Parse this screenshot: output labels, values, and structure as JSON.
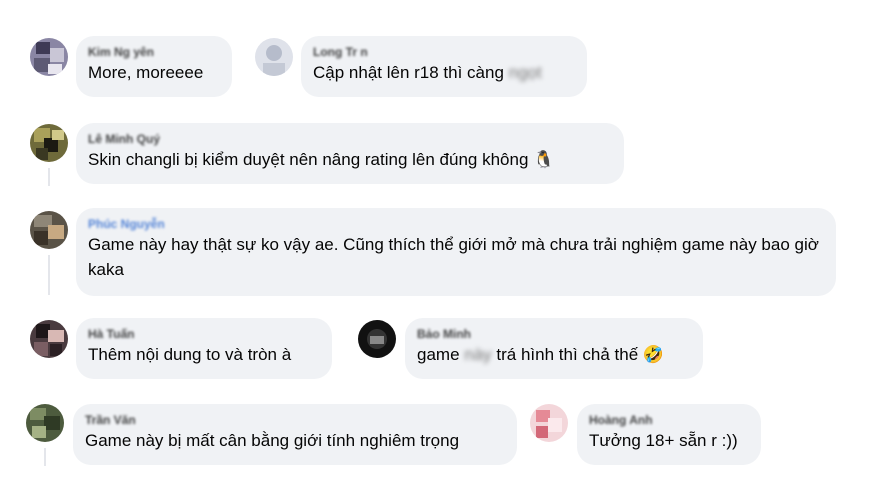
{
  "comments": [
    {
      "id": "c1",
      "author": "Kim Ng yên",
      "text": "More, moreeee",
      "blurred": ""
    },
    {
      "id": "c2",
      "author": "Long Tr n",
      "text": "Cập nhật lên r18 thì càng ",
      "blurred": "ngọt"
    },
    {
      "id": "c3",
      "author": "Lê Minh Quý",
      "text": "Skin changli bị kiểm duyệt nên nâng rating lên đúng không",
      "emoji": "🐧"
    },
    {
      "id": "c4",
      "author": "Phúc Nguyễn",
      "text": "Game này hay thật sự ko vậy ae. Cũng thích thể giới mở mà chưa trải nghiệm game này bao giờ kaka"
    },
    {
      "id": "c5",
      "author": "Hà Tuấn",
      "text": "Thêm nội dung to và tròn à"
    },
    {
      "id": "c6",
      "author": "Bảo Minh",
      "text_before": "game ",
      "blurred": "này",
      "text_after": " trá hình thì chả thế",
      "emoji": "🤣"
    },
    {
      "id": "c7",
      "author": "Trần Văn",
      "text": "Game này bị mất cân bằng giới tính nghiêm trọng"
    },
    {
      "id": "c8",
      "author": "Hoàng Anh",
      "text": "Tưởng 18+ sẵn r :))"
    }
  ],
  "colors": {
    "bubble": "#f0f2f5",
    "text": "#050505",
    "thread": "#e4e6eb"
  }
}
